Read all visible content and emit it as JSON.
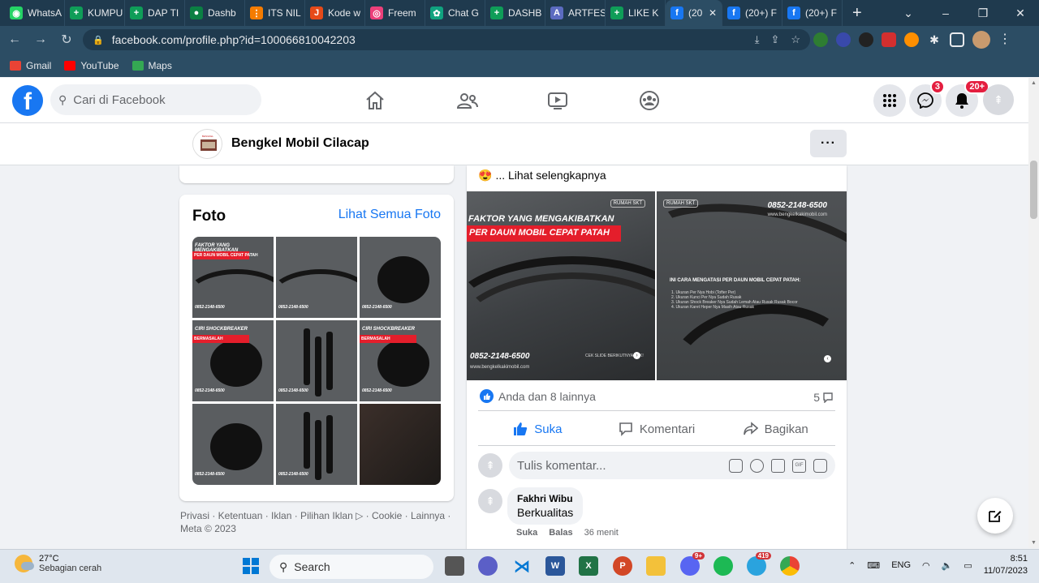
{
  "browser": {
    "tabs": [
      {
        "label": "WhatsA",
        "color": "#25d366",
        "glyph": "◉"
      },
      {
        "label": "KUMPU",
        "color": "#0f9d58",
        "glyph": "+"
      },
      {
        "label": "DAP TI",
        "color": "#0f9d58",
        "glyph": "+"
      },
      {
        "label": "Dashb",
        "color": "#0b8043",
        "glyph": "●"
      },
      {
        "label": "ITS NIL",
        "color": "#f57c00",
        "glyph": "⋮"
      },
      {
        "label": "Kode w",
        "color": "#e64a19",
        "glyph": "J"
      },
      {
        "label": "Freem",
        "color": "#ec407a",
        "glyph": "◎"
      },
      {
        "label": "Chat G",
        "color": "#10a37f",
        "glyph": "✿"
      },
      {
        "label": "DASHB",
        "color": "#0f9d58",
        "glyph": "+"
      },
      {
        "label": "ARTFES",
        "color": "#5c6bc0",
        "glyph": "A"
      },
      {
        "label": "LIKE K",
        "color": "#0f9d58",
        "glyph": "+"
      },
      {
        "label": "(20",
        "color": "#1877f2",
        "glyph": "f",
        "active": true
      },
      {
        "label": "(20+) F",
        "color": "#1877f2",
        "glyph": "f"
      },
      {
        "label": "(20+) F",
        "color": "#1877f2",
        "glyph": "f"
      }
    ],
    "url": "facebook.com/profile.php?id=100066810042203",
    "bookmarks": [
      {
        "label": "Gmail",
        "color": "#ea4335"
      },
      {
        "label": "YouTube",
        "color": "#ff0000"
      },
      {
        "label": "Maps",
        "color": "#34a853"
      }
    ]
  },
  "facebook": {
    "search_placeholder": "Cari di Facebook",
    "messenger_badge": "3",
    "notif_badge": "20+",
    "page_name": "Bengkel Mobil Cilacap",
    "photos_title": "Foto",
    "photos_see_all": "Lihat Semua Foto",
    "thumbs": [
      {
        "line1": "FAKTOR YANG MENGAKIBATKAN",
        "line2": "PER DAUN MOBIL CEPAT PATAH",
        "phone": "0852-2148-6500",
        "kind": "leaf"
      },
      {
        "line1": "",
        "line2": "",
        "phone": "0852-2148-6500",
        "kind": "leaf2"
      },
      {
        "line1": "",
        "line2": "",
        "phone": "0852-2148-6500",
        "kind": "mount"
      },
      {
        "line1": "CIRI SHOCKBREAKER",
        "line2": "BERMASALAH",
        "phone": "0852-2148-6500",
        "kind": "mount"
      },
      {
        "line1": "",
        "line2": "",
        "phone": "0852-2148-6500",
        "kind": "shocks"
      },
      {
        "line1": "CIRI SHOCKBREAKER",
        "line2": "BERMASALAH",
        "phone": "0852-2148-6500",
        "kind": "mount"
      },
      {
        "line1": "",
        "line2": "",
        "phone": "0852-2148-6500",
        "kind": "mount"
      },
      {
        "line1": "",
        "line2": "",
        "phone": "0852-2148-6500",
        "kind": "shocks"
      },
      {
        "line1": "",
        "line2": "",
        "phone": "",
        "kind": "engine"
      }
    ],
    "footer": "Privasi · Ketentuan · Iklan · Pilihan Iklan ▷ · Cookie · Lainnya · Meta © 2023",
    "post": {
      "see_more": "... Lihat selengkapnya",
      "img1_title1": "FAKTOR YANG MENGAKIBATKAN",
      "img1_title2": "PER DAUN MOBIL CEPAT PATAH",
      "img1_phone": "0852-2148-6500",
      "img1_web": "www.bengkelkakimobil.com",
      "img1_slide": "CEK SLIDE BERIKUTNYA YUK!",
      "img2_phone": "0852-2148-6500",
      "img2_web": "www.bengkelkakimobil.com",
      "img2_head": "INI CARA MENGATASI PER DAUN MOBIL CEPAT PATAH:",
      "img2_list": "1. Ukuran Per Nya Hobi (Tofter Per)\n2. Ukuran Kunci Per Nya Sudah Rusak\n3. Ukuran Shock Breaker Nya Sudah Lemah Atau Rusak Rusak Bocor\n4. Ukuran Karet Heper Nya Masih Atau Rusak",
      "reactions": "Anda dan 8 lainnya",
      "comments_count": "5",
      "like": "Suka",
      "comment": "Komentari",
      "share": "Bagikan",
      "comment_placeholder": "Tulis komentar...",
      "comment_author": "Fakhri Wibu",
      "comment_text": "Berkualitas",
      "comment_like": "Suka",
      "comment_reply": "Balas",
      "comment_time": "36 menit"
    }
  },
  "taskbar": {
    "temp": "27°C",
    "weather": "Sebagian cerah",
    "search": "Search",
    "lang": "ENG",
    "time": "8:51",
    "date": "11/07/2023",
    "discord_badge": "9+",
    "telegram_badge": "419"
  },
  "colors": {
    "fb_blue": "#1877f2",
    "badge_red": "#e41e3f"
  }
}
